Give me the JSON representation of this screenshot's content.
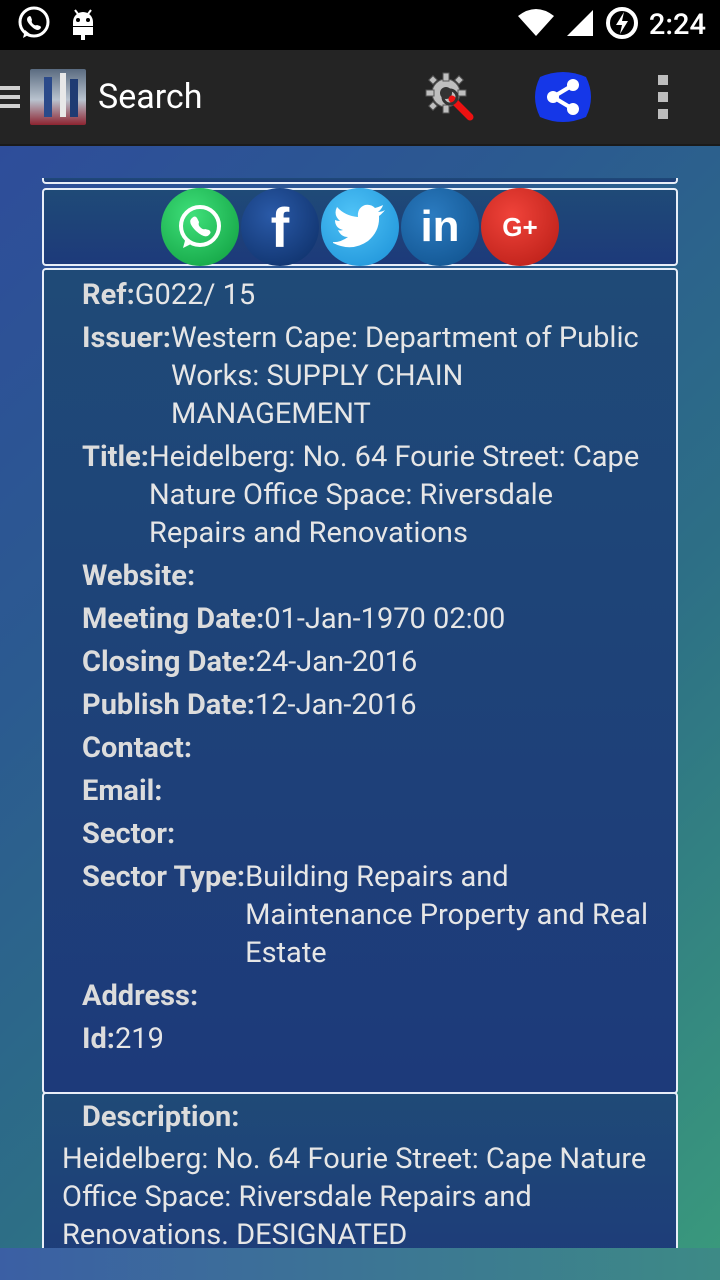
{
  "status_bar": {
    "time": "2:24",
    "icons": [
      "whatsapp-icon",
      "android-debug-icon",
      "wifi-icon",
      "signal-icon",
      "battery-charging-icon"
    ]
  },
  "action_bar": {
    "title": "Search",
    "icons": [
      "hamburger-icon",
      "app-logo",
      "settings-search-icon",
      "share-icon",
      "overflow-menu-icon"
    ]
  },
  "share_buttons": [
    {
      "name": "whatsapp",
      "glyph": ""
    },
    {
      "name": "facebook",
      "glyph": "f"
    },
    {
      "name": "twitter",
      "glyph": ""
    },
    {
      "name": "linkedin",
      "glyph": "in"
    },
    {
      "name": "google-plus",
      "glyph": "G+"
    }
  ],
  "details": {
    "ref_label": "Ref:",
    "ref_value": "G022/ 15",
    "issuer_label": "Issuer:",
    "issuer_value": "Western Cape: Department of Public Works: SUPPLY CHAIN MANAGEMENT",
    "title_label": "Title:",
    "title_value": "Heidelberg: No. 64 Fourie Street: Cape Nature Office Space: Riversdale Repairs and Renovations",
    "website_label": "Website:",
    "website_value": "",
    "meeting_label": "Meeting Date:",
    "meeting_value": "01-Jan-1970 02:00",
    "closing_label": "Closing Date:",
    "closing_value": "24-Jan-2016",
    "publish_label": "Publish Date:",
    "publish_value": "12-Jan-2016",
    "contact_label": "Contact:",
    "contact_value": "",
    "email_label": "Email:",
    "email_value": "",
    "sector_label": "Sector:",
    "sector_value": "",
    "sector_type_label": "Sector Type:",
    "sector_type_value": "Building Repairs and Maintenance Property and Real Estate",
    "address_label": "Address:",
    "address_value": "",
    "id_label": "Id:",
    "id_value": "219"
  },
  "description": {
    "label": "Description:",
    "text": "Heidelberg: No. 64 Fourie Street: Cape Nature Office Space: Riversdale Repairs and Renovations. DESIGNATED"
  }
}
